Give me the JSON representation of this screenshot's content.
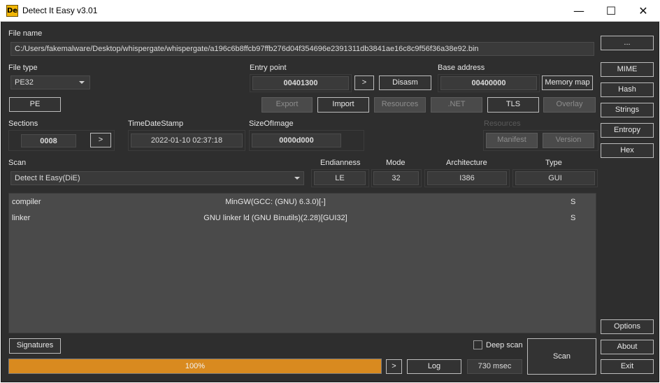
{
  "window": {
    "title": "Detect It Easy v3.01",
    "icon_label": "De",
    "minimize_glyph": "—",
    "maximize_glyph": "☐",
    "close_glyph": "✕"
  },
  "file": {
    "label": "File name",
    "path": "C:/Users/fakemalware/Desktop/whispergate/whispergate/a196c6b8ffcb97ffb276d04f354696e2391311db3841ae16c8c9f56f36a38e92.bin",
    "browse_label": "..."
  },
  "file_type": {
    "label": "File type",
    "value": "PE32",
    "pe_button": "PE"
  },
  "entry_point": {
    "label": "Entry point",
    "value": "00401300",
    "go_label": ">",
    "disasm_label": "Disasm"
  },
  "base_address": {
    "label": "Base address",
    "value": "00400000",
    "memory_map_label": "Memory map"
  },
  "sections_buttons": {
    "export": "Export",
    "import": "Import",
    "resources": "Resources",
    "dotnet": ".NET",
    "tls": "TLS",
    "overlay": "Overlay"
  },
  "sections": {
    "label": "Sections",
    "value": "0008",
    "go_label": ">"
  },
  "timestamp": {
    "label": "TimeDateStamp",
    "value": "2022-01-10 02:37:18"
  },
  "size_of_image": {
    "label": "SizeOfImage",
    "value": "0000d000"
  },
  "resources_group": {
    "label": "Resources",
    "manifest": "Manifest",
    "version": "Version"
  },
  "scan": {
    "label": "Scan",
    "engine": "Detect It Easy(DiE)"
  },
  "endianness": {
    "label": "Endianness",
    "value": "LE"
  },
  "mode": {
    "label": "Mode",
    "value": "32"
  },
  "architecture": {
    "label": "Architecture",
    "value": "I386"
  },
  "type": {
    "label": "Type",
    "value": "GUI"
  },
  "results": [
    {
      "type": "compiler",
      "name": "MinGW(GCC: (GNU) 6.3.0)[-]",
      "flag": "S"
    },
    {
      "type": "linker",
      "name": "GNU linker ld (GNU Binutils)(2.28)[GUI32]",
      "flag": "S"
    }
  ],
  "right_panel": {
    "mime": "MIME",
    "hash": "Hash",
    "strings": "Strings",
    "entropy": "Entropy",
    "hex": "Hex",
    "options": "Options",
    "about": "About",
    "exit": "Exit"
  },
  "bottom": {
    "signatures": "Signatures",
    "deep_scan_label": "Deep scan",
    "deep_scan_checked": false,
    "scan_button": "Scan",
    "progress_percent": 100,
    "progress_text": "100%",
    "progress_go": ">",
    "log": "Log",
    "elapsed": "730 msec"
  },
  "colors": {
    "background": "#2e2e2e",
    "field": "#3a3a3a",
    "results_bg": "#4a4a4a",
    "progress_fill": "#d98a1f",
    "icon_accent": "#f2b705"
  }
}
